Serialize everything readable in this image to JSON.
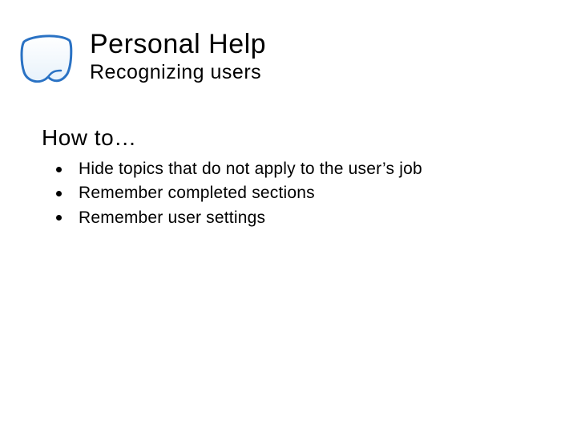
{
  "header": {
    "icon": "note-page-icon",
    "title": "Personal Help",
    "subtitle": "Recognizing users"
  },
  "body": {
    "heading": "How to…",
    "bullets": [
      "Hide topics that do not apply to the user’s job",
      "Remember completed sections",
      "Remember user settings"
    ]
  }
}
